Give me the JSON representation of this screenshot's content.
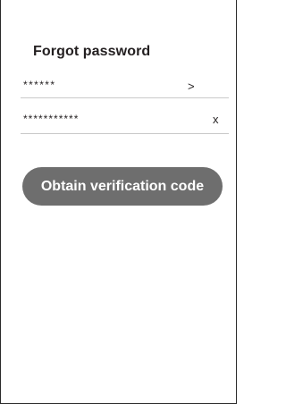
{
  "page": {
    "title": "Forgot password"
  },
  "form": {
    "region_field": {
      "value": "******",
      "action_icon": "chevron-right-icon",
      "action_glyph": ">"
    },
    "account_field": {
      "value": "***********",
      "action_icon": "clear-icon",
      "action_glyph": "x"
    }
  },
  "actions": {
    "obtain_code_label": "Obtain verification code"
  },
  "colors": {
    "button_background": "#6e6e6e",
    "button_text": "#ffffff",
    "divider": "#c9c9c9",
    "text": "#231f20"
  }
}
